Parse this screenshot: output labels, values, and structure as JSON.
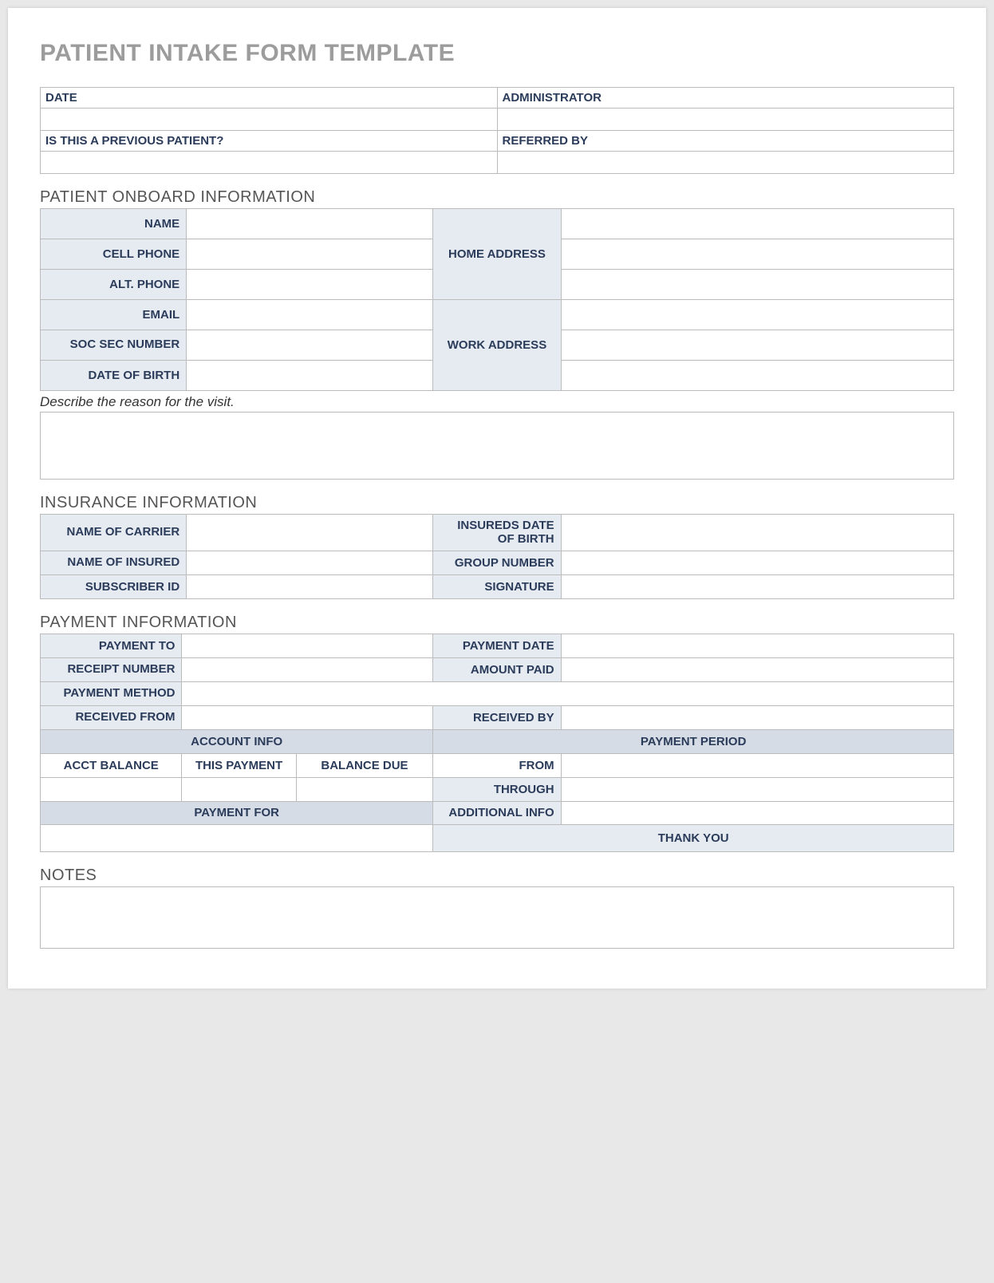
{
  "title": "PATIENT INTAKE FORM TEMPLATE",
  "header": {
    "date_label": "DATE",
    "date_value": "",
    "admin_label": "ADMINISTRATOR",
    "admin_value": "",
    "prev_label": "IS THIS A PREVIOUS PATIENT?",
    "prev_value": "",
    "ref_label": "REFERRED BY",
    "ref_value": ""
  },
  "sections": {
    "onboard_title": "PATIENT ONBOARD INFORMATION",
    "insurance_title": "INSURANCE INFORMATION",
    "payment_title": "PAYMENT INFORMATION",
    "notes_title": "NOTES"
  },
  "onboard": {
    "name_label": "NAME",
    "name_value": "",
    "cell_label": "CELL PHONE",
    "cell_value": "",
    "alt_label": "ALT. PHONE",
    "alt_value": "",
    "email_label": "EMAIL",
    "email_value": "",
    "ssn_label": "SOC SEC NUMBER",
    "ssn_value": "",
    "dob_label": "DATE OF BIRTH",
    "dob_value": "",
    "home_addr_label": "HOME ADDRESS",
    "home_addr_1": "",
    "home_addr_2": "",
    "home_addr_3": "",
    "work_addr_label": "WORK ADDRESS",
    "work_addr_1": "",
    "work_addr_2": "",
    "work_addr_3": ""
  },
  "visit_reason_label": "Describe the reason for the visit.",
  "visit_reason_value": "",
  "insurance": {
    "carrier_label": "NAME OF CARRIER",
    "carrier_value": "",
    "insured_label": "NAME OF INSURED",
    "insured_value": "",
    "subscriber_label": "SUBSCRIBER ID",
    "subscriber_value": "",
    "ins_dob_label": "INSUREDS DATE OF BIRTH",
    "ins_dob_value": "",
    "group_label": "GROUP NUMBER",
    "group_value": "",
    "sig_label": "SIGNATURE",
    "sig_value": ""
  },
  "payment": {
    "to_label": "PAYMENT TO",
    "to_value": "",
    "date_label": "PAYMENT DATE",
    "date_value": "",
    "receipt_label": "RECEIPT NUMBER",
    "receipt_value": "",
    "amount_label": "AMOUNT PAID",
    "amount_value": "",
    "method_label": "PAYMENT METHOD",
    "method_value": "",
    "rec_from_label": "RECEIVED FROM",
    "rec_from_value": "",
    "rec_by_label": "RECEIVED BY",
    "rec_by_value": "",
    "acct_info_label": "ACCOUNT INFO",
    "period_label": "PAYMENT PERIOD",
    "acct_bal_label": "ACCT BALANCE",
    "acct_bal_value": "",
    "this_pay_label": "THIS PAYMENT",
    "this_pay_value": "",
    "bal_due_label": "BALANCE DUE",
    "bal_due_value": "",
    "from_label": "FROM",
    "from_value": "",
    "through_label": "THROUGH",
    "through_value": "",
    "pay_for_label": "PAYMENT FOR",
    "pay_for_value": "",
    "addl_label": "ADDITIONAL INFO",
    "addl_value": "",
    "thank_label": "THANK YOU"
  },
  "notes_value": ""
}
